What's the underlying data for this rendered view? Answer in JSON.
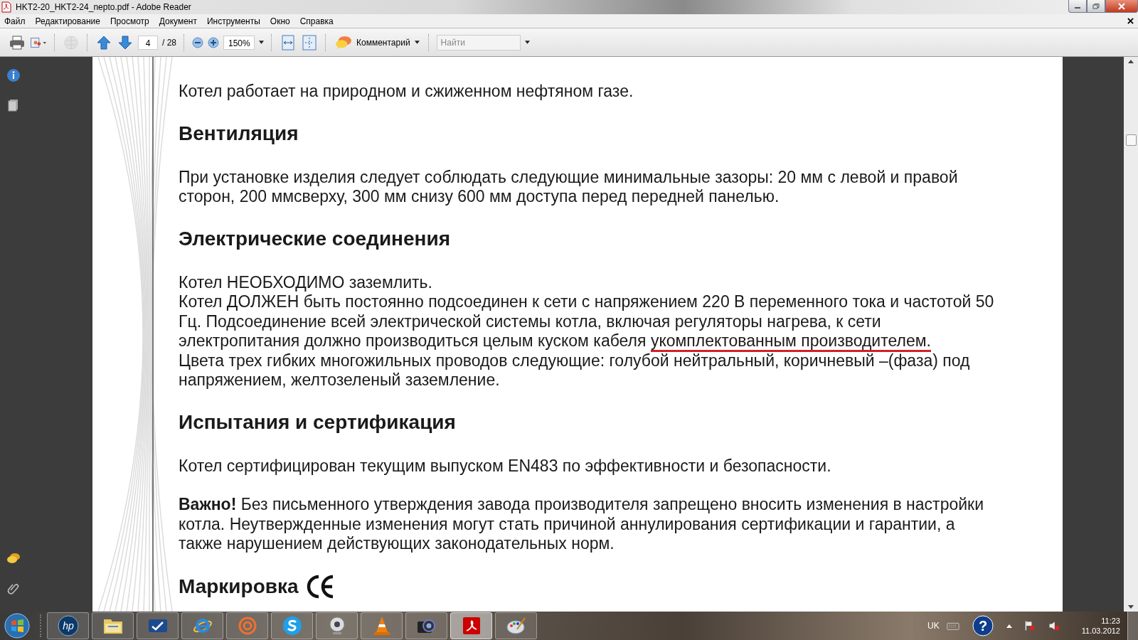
{
  "window": {
    "title": "HKT2-20_HKT2-24_nepto.pdf - Adobe Reader"
  },
  "menu": [
    "Файл",
    "Редактирование",
    "Просмотр",
    "Документ",
    "Инструменты",
    "Окно",
    "Справка"
  ],
  "toolbar": {
    "page_field": "4",
    "page_total": "/ 28",
    "zoom_field": "150%",
    "comment_button": "Комментарий",
    "search": {
      "placeholder": "Найти"
    }
  },
  "document": [
    {
      "kind": "paragraph",
      "lines": [
        {
          "text": "Котел работает на природном и сжиженном нефтяном газе."
        }
      ]
    },
    {
      "kind": "heading",
      "text": "Вентиляция",
      "ce_mark": false
    },
    {
      "kind": "paragraph",
      "lines": [
        {
          "text": "При установке изделия следует соблюдать следующие минимальные зазоры: 20 мм с левой и правой сторон, 200 ммсверху, 300 мм снизу 600 мм доступа перед передней панелью."
        }
      ]
    },
    {
      "kind": "heading",
      "text": "Электрические соединения",
      "ce_mark": false
    },
    {
      "kind": "paragraph",
      "lines": [
        {
          "text": "Котел НЕОБХОДИМО заземлить."
        },
        {
          "text": "Котел ДОЛЖЕН быть постоянно подсоединен к сети с напряжением 220 В переменного тока и частотой 50 Гц. Подсоединение всей электрической системы котла, включая регуляторы нагрева, к сети электропитания должно производиться целым куском кабеля ",
          "underlined": "укомплектованным производителем."
        },
        {
          "text": "Цвета трех гибких многожильных проводов следующие: голубой  нейтральный, коричневый –(фаза) под напряжением, желтозеленый заземление."
        }
      ]
    },
    {
      "kind": "heading",
      "text": "Испытания и сертификация",
      "ce_mark": false
    },
    {
      "kind": "paragraph",
      "lines": [
        {
          "text": "Котел сертифицирован текущим выпуском EN483 по эффективности и безопасности."
        }
      ]
    },
    {
      "kind": "paragraph",
      "lines": [
        {
          "text": "**Важно!** Без письменного утверждения завода производителя запрещено вносить изменения в настройки котла. Неутвержденные изменения могут стать причиной аннулирования сертификации и гарантии, а также нарушением действующих законодательных норм."
        }
      ]
    },
    {
      "kind": "heading",
      "text": "Маркировка",
      "ce_mark": true
    }
  ],
  "taskbar": {
    "apps": [
      {
        "kind": "hp",
        "label": "hp",
        "selected": false
      },
      {
        "kind": "folder",
        "selected": false
      },
      {
        "kind": "check",
        "selected": false
      },
      {
        "kind": "browser",
        "selected": false
      },
      {
        "kind": "at",
        "selected": false
      },
      {
        "kind": "chat",
        "selected": false
      },
      {
        "kind": "webcam",
        "selected": false
      },
      {
        "kind": "cone",
        "selected": false
      },
      {
        "kind": "camera",
        "selected": false
      },
      {
        "kind": "pdf",
        "selected": true
      },
      {
        "kind": "palette",
        "selected": false
      }
    ],
    "help": "?",
    "language": "UK",
    "time": "11:23",
    "date": "11.03.2012"
  }
}
